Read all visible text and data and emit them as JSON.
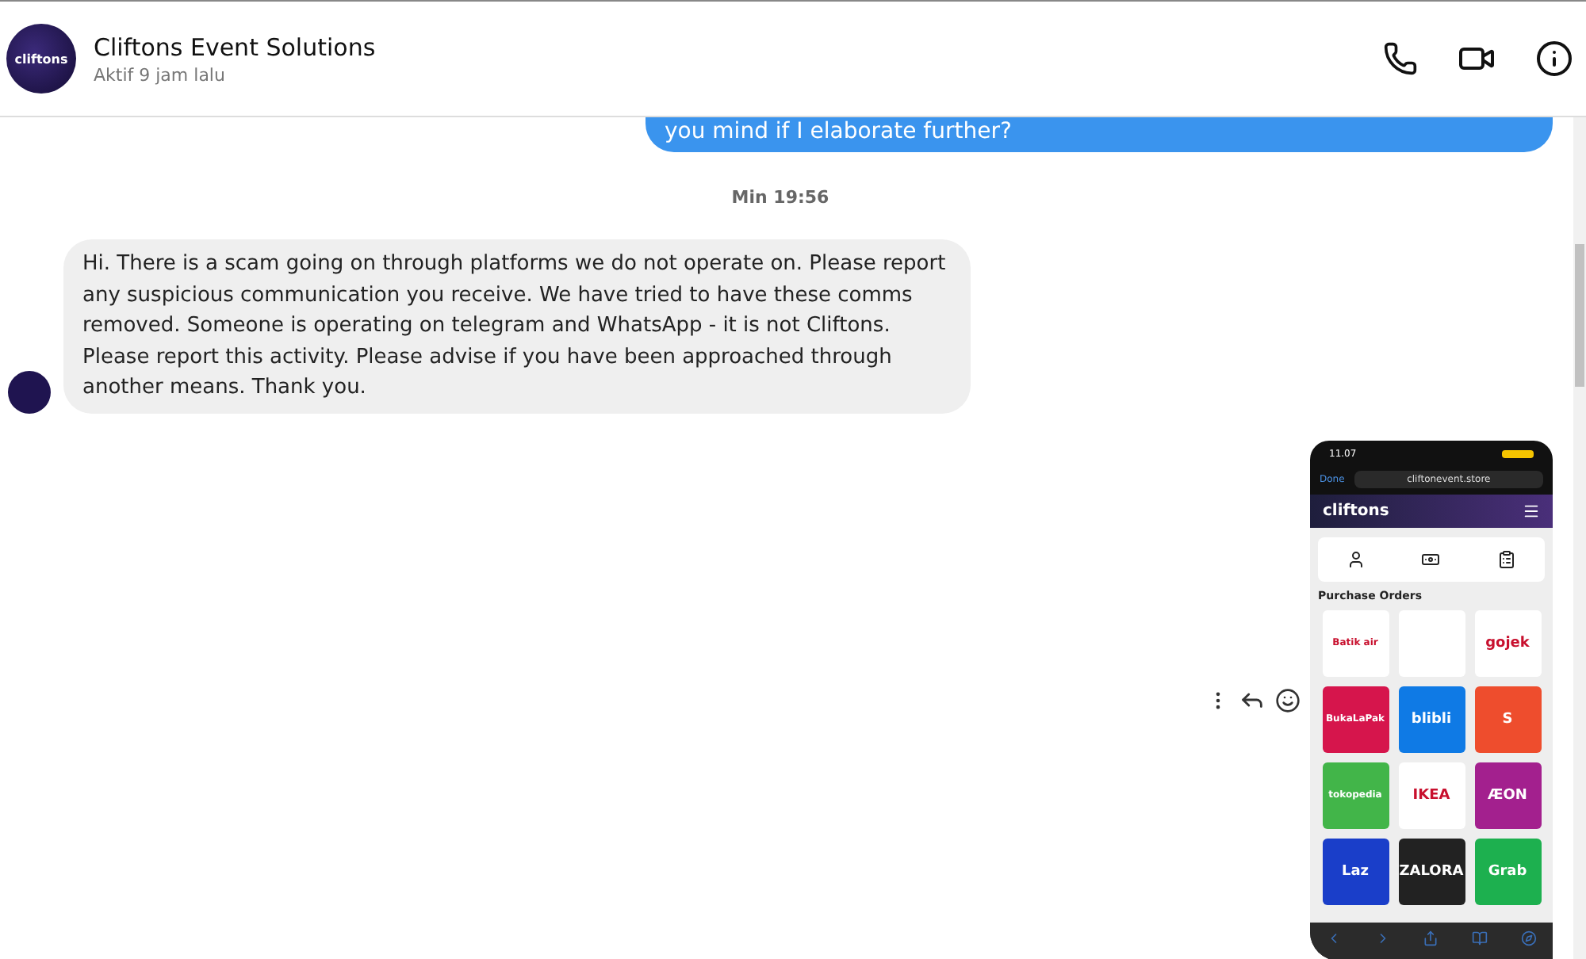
{
  "header": {
    "name": "Cliftons Event Solutions",
    "status": "Aktif 9 jam lalu",
    "avatar_text": "cliftons"
  },
  "messages": [
    {
      "kind": "outgoing",
      "text": "you mind if I elaborate further?"
    },
    {
      "kind": "timestamp",
      "text": "Min 19:56"
    },
    {
      "kind": "incoming",
      "text": "Hi. There is a scam going on through platforms we do not operate on. Please report any suspicious communication you receive. We have tried to have these comms removed. Someone is operating on telegram and WhatsApp - it is not Cliftons. Please report this activity. Please advise if you have been approached through another means. Thank you."
    },
    {
      "kind": "image",
      "phone": {
        "time": "11.07",
        "done": "Done",
        "url": "cliftonevent.store",
        "brand": "cliftons",
        "section": "Purchase Orders",
        "tiles": [
          {
            "label": "Batik air",
            "color": "#ffffff"
          },
          {
            "color": "#ffffff"
          },
          {
            "label": "gojek",
            "color": "#ffffff"
          },
          {
            "label": "BukaLaPak",
            "color": "#d6154c"
          },
          {
            "label": "blibli",
            "color": "#0f7ae5"
          },
          {
            "label": "S",
            "color": "#ee4d2d"
          },
          {
            "label": "tokopedia",
            "color": "#42b549"
          },
          {
            "label": "IKEA",
            "color": "#ffffff"
          },
          {
            "label": "ÆON",
            "color": "#a3208e"
          },
          {
            "label": "Laz",
            "color": "#1a3ec9"
          },
          {
            "label": "ZALORA",
            "color": "#222222"
          },
          {
            "label": "Grab",
            "color": "#1db04f"
          }
        ]
      }
    }
  ]
}
